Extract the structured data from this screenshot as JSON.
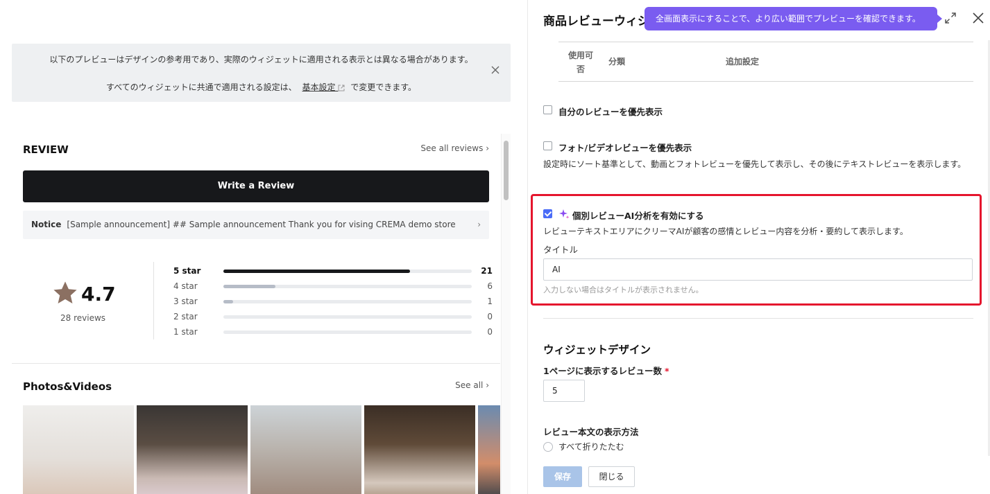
{
  "notice": {
    "line1": "以下のプレビューはデザインの参考用であり、実際のウィジェットに適用される表示とは異なる場合があります。",
    "line2_before": "すべてのウィジェットに共通で適用される設定は、",
    "line2_link": "基本設定",
    "line2_after": "で変更できます。"
  },
  "preview": {
    "review_title": "REVIEW",
    "see_all_reviews": "See all reviews ›",
    "write_review": "Write a Review",
    "notice_label": "Notice",
    "notice_text": "[Sample announcement] ## Sample announcement Thank you for vising CREMA demo store",
    "notice_chevron": "›",
    "rating": "4.7",
    "review_count": "28 reviews",
    "rating_rows": [
      {
        "label": "5 star",
        "count": "21",
        "fraction": 0.75
      },
      {
        "label": "4 star",
        "count": "6",
        "fraction": 0.21
      },
      {
        "label": "3 star",
        "count": "1",
        "fraction": 0.04
      },
      {
        "label": "2 star",
        "count": "0",
        "fraction": 0
      },
      {
        "label": "1 star",
        "count": "0",
        "fraction": 0
      }
    ],
    "photos_title": "Photos&Videos",
    "photos_see_all": "See all ›"
  },
  "panel": {
    "title": "商品レビューウィジ",
    "tooltip": "全画面表示にすることで、より広い範囲でプレビューを確認できます。",
    "table_headers": {
      "use": "使用可否",
      "category": "分類",
      "extra": "追加設定"
    },
    "opt_own_first": "自分のレビューを優先表示",
    "opt_media_first": "フォト/ビデオレビューを優先表示",
    "media_desc": "設定時にソート基準として、動画とフォトレビューを優先して表示し、その後にテキストレビューを表示します。",
    "ai_label": "個別レビューAI分析を有効にする",
    "ai_desc": "レビューテキストエリアにクリーマAIが顧客の感情とレビュー内容を分析・要約して表示します。",
    "title_label": "タイトル",
    "title_value": "AI",
    "title_hint": "入力しない場合はタイトルが表示されません。",
    "design_heading": "ウィジェットデザイン",
    "per_page_label": "1ページに表示するレビュー数",
    "per_page_required": "*",
    "per_page_value": "5",
    "body_display_label": "レビュー本文の表示方法",
    "collapse_all": "すべて折りたたむ",
    "save": "保存",
    "close": "閉じる"
  },
  "colors": {
    "accent": "#7a5cf0",
    "highlight": "#e5152d",
    "checkbox": "#4a6cf7",
    "save_disabled": "#a9c4e8"
  }
}
